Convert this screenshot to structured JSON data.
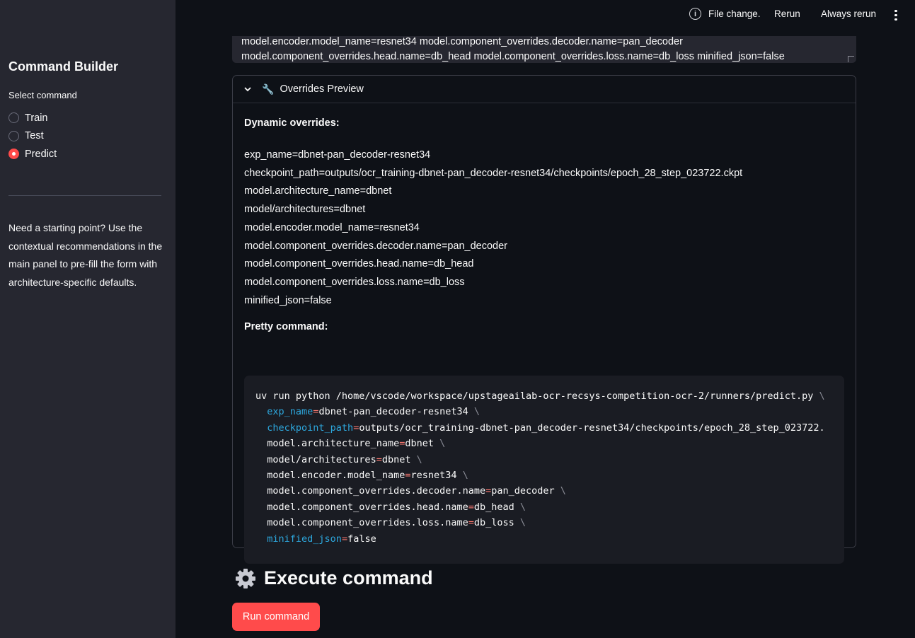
{
  "sidebar": {
    "title": "Command Builder",
    "select_label": "Select command",
    "options": [
      "Train",
      "Test",
      "Predict"
    ],
    "selected": "Predict",
    "help_text": "Need a starting point? Use the contextual recommendations in the main panel to pre-fill the form with architecture-specific defaults."
  },
  "header": {
    "status": "File change.",
    "rerun": "Rerun",
    "always_rerun": "Always rerun"
  },
  "command_text": {
    "lines": [
      "model.encoder.model_name=resnet34 model.component_overrides.decoder.name=pan_decoder",
      "model.component_overrides.head.name=db_head model.component_overrides.loss.name=db_loss minified_json=false"
    ]
  },
  "overrides_preview": {
    "label": "Overrides Preview",
    "dynamic_title": "Dynamic overrides:",
    "dynamic_overrides": [
      "exp_name=dbnet-pan_decoder-resnet34",
      "checkpoint_path=outputs/ocr_training-dbnet-pan_decoder-resnet34/checkpoints/epoch_28_step_023722.ckpt",
      "model.architecture_name=dbnet",
      "model/architectures=dbnet",
      "model.encoder.model_name=resnet34",
      "model.component_overrides.decoder.name=pan_decoder",
      "model.component_overrides.head.name=db_head",
      "model.component_overrides.loss.name=db_loss",
      "minified_json=false"
    ],
    "pretty_title": "Pretty command:",
    "pretty_command": {
      "first": "uv run python /home/vscode/workspace/upstageailab-ocr-recsys-competition-ocr-2/runners/predict.py",
      "args": [
        {
          "key": "exp_name",
          "value": "dbnet-pan_decoder-resnet34",
          "highlight": true,
          "cont": true
        },
        {
          "key": "checkpoint_path",
          "value": "outputs/ocr_training-dbnet-pan_decoder-resnet34/checkpoints/epoch_28_step_023722.",
          "highlight": true,
          "cont": false
        },
        {
          "key": "model.architecture_name",
          "value": "dbnet",
          "highlight": false,
          "cont": true
        },
        {
          "key": "model/architectures",
          "value": "dbnet",
          "highlight": false,
          "cont": true
        },
        {
          "key": "model.encoder.model_name",
          "value": "resnet34",
          "highlight": false,
          "cont": true
        },
        {
          "key": "model.component_overrides.decoder.name",
          "value": "pan_decoder",
          "highlight": false,
          "cont": true
        },
        {
          "key": "model.component_overrides.head.name",
          "value": "db_head",
          "highlight": false,
          "cont": true
        },
        {
          "key": "model.component_overrides.loss.name",
          "value": "db_loss",
          "highlight": false,
          "cont": true
        },
        {
          "key": "minified_json",
          "value": "false",
          "highlight": true,
          "cont": false
        }
      ]
    }
  },
  "execute": {
    "title": "Execute command",
    "button": "Run command"
  },
  "colors": {
    "accent": "#ff4b4b",
    "sidebar_bg": "#262730",
    "main_bg": "#0e1117",
    "code_key": "#2da8de"
  }
}
